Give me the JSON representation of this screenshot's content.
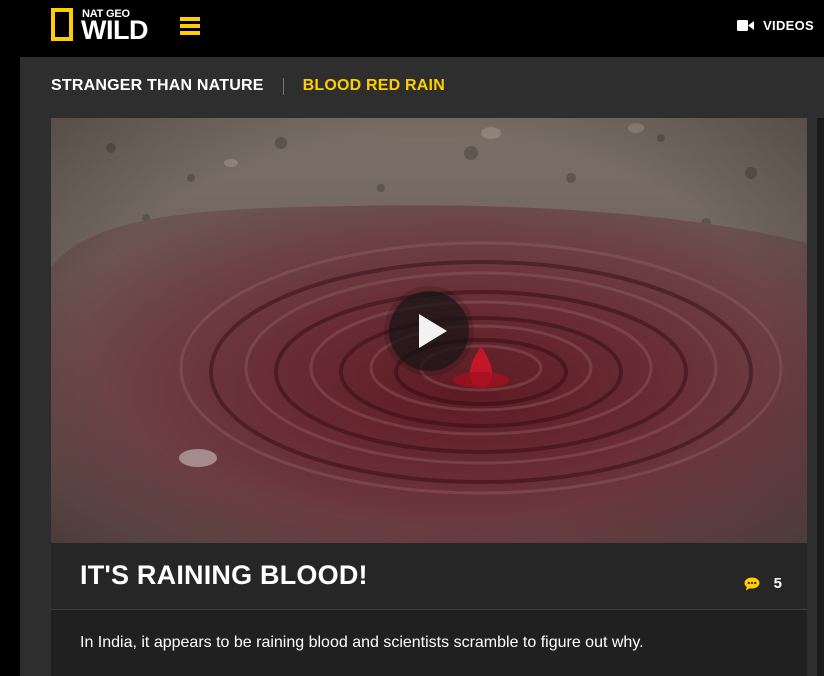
{
  "header": {
    "logo_top": "NAT GEO",
    "logo_main": "WILD",
    "videos_label": "VIDEOS"
  },
  "breadcrumb": {
    "parent": "STRANGER THAN NATURE",
    "current": "BLOOD RED RAIN"
  },
  "video": {
    "title": "IT'S RAINING BLOOD!",
    "comment_count": "5",
    "description": "In India, it appears to be raining blood and scientists scramble to figure out why."
  },
  "colors": {
    "accent": "#ffce00",
    "background": "#000000",
    "panel": "#2e2e2e",
    "card": "#262626"
  },
  "icons": {
    "menu": "hamburger-icon",
    "videos": "video-camera-icon",
    "play": "play-icon",
    "comments": "comment-bubble-icon"
  }
}
